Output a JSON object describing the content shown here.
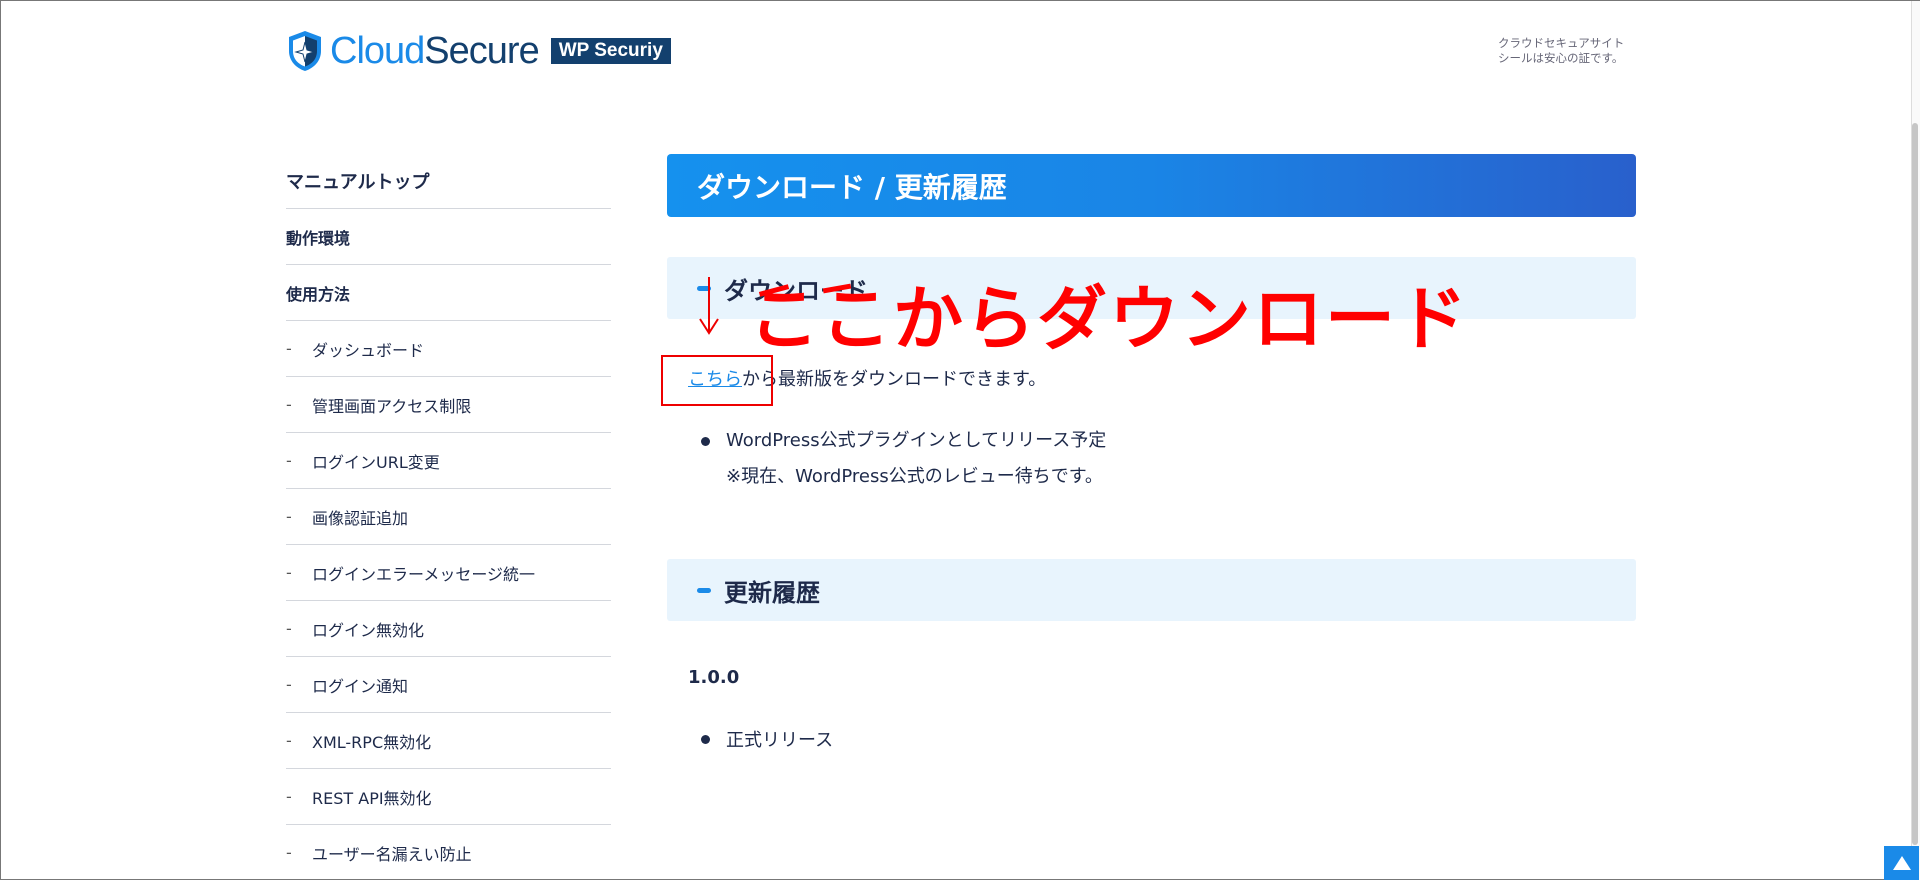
{
  "header": {
    "logo_part1": "Cloud",
    "logo_part2": "Secure",
    "logo_tag": "WP Securiy",
    "seal_line1": "クラウドセキュアサイト",
    "seal_line2": "シールは安心の証です。"
  },
  "sidebar": {
    "items": [
      {
        "label": "マニュアルトップ",
        "type": "top"
      },
      {
        "label": "動作環境",
        "type": "bold"
      },
      {
        "label": "使用方法",
        "type": "bold"
      },
      {
        "label": "ダッシュボード",
        "type": "sub"
      },
      {
        "label": "管理画面アクセス制限",
        "type": "sub"
      },
      {
        "label": "ログインURL変更",
        "type": "sub"
      },
      {
        "label": "画像認証追加",
        "type": "sub"
      },
      {
        "label": "ログインエラーメッセージ統一",
        "type": "sub"
      },
      {
        "label": "ログイン無効化",
        "type": "sub"
      },
      {
        "label": "ログイン通知",
        "type": "sub"
      },
      {
        "label": "XML-RPC無効化",
        "type": "sub"
      },
      {
        "label": "REST API無効化",
        "type": "sub"
      },
      {
        "label": "ユーザー名漏えい防止",
        "type": "sub"
      }
    ],
    "dash": "-"
  },
  "main": {
    "title": "ダウンロード / 更新履歴",
    "download": {
      "heading": "ダウンロード",
      "link": "こちら",
      "text": "から最新版をダウンロードできます。",
      "bullet_line1": "WordPress公式プラグインとしてリリース予定",
      "bullet_line2": "※現在、WordPress公式のレビュー待ちです。"
    },
    "history": {
      "heading": "更新履歴",
      "version": "1.0.0",
      "note": "正式リリース"
    }
  },
  "annotation": {
    "text": "ここからダウンロード",
    "arrow": "↓",
    "color": "#ff0000"
  },
  "colors": {
    "accent": "#1a8ae8",
    "navy": "#13406e"
  }
}
